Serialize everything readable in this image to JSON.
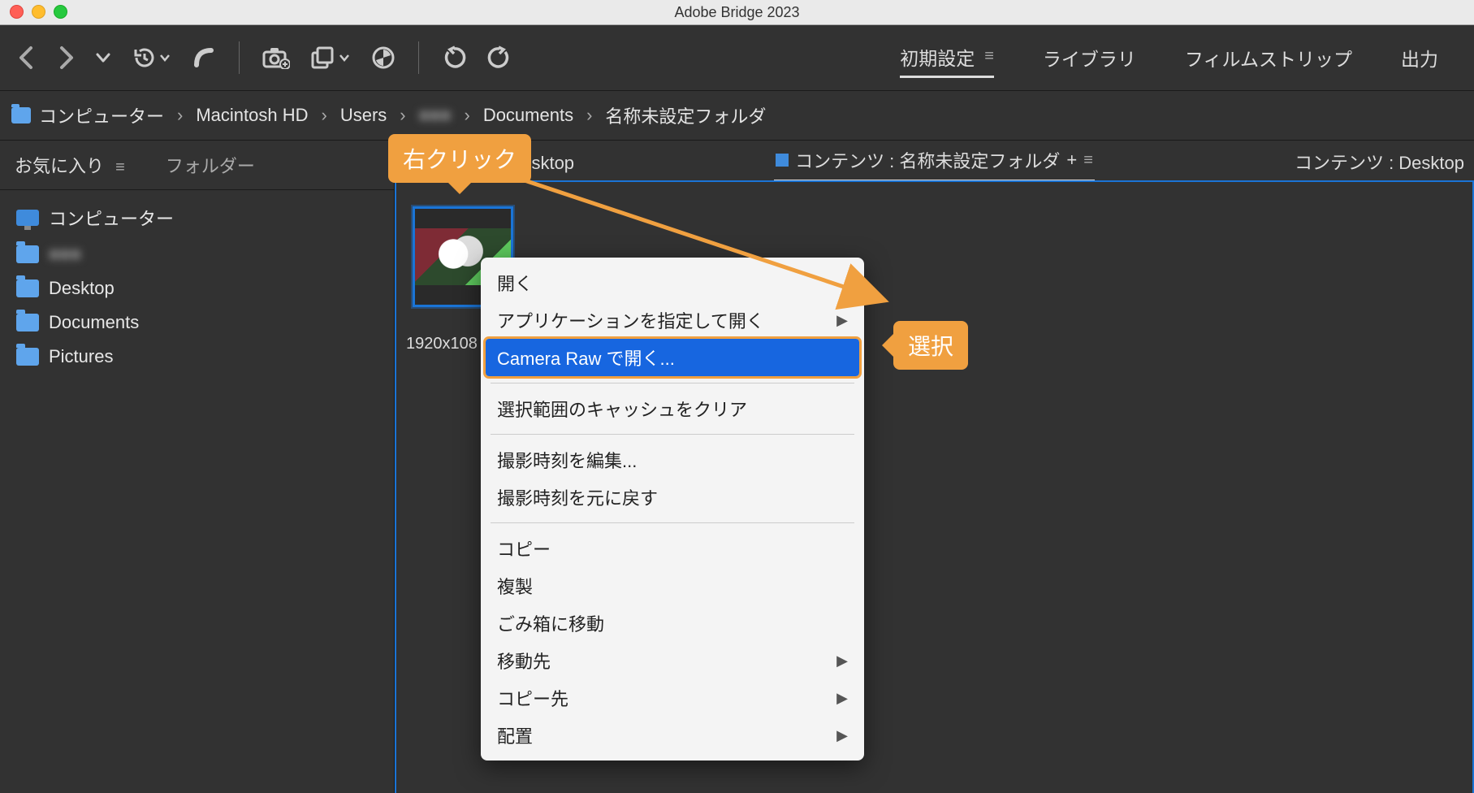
{
  "window": {
    "title": "Adobe Bridge 2023"
  },
  "workspaces": {
    "items": [
      {
        "label": "初期設定",
        "active": true
      },
      {
        "label": "ライブラリ"
      },
      {
        "label": "フィルムストリップ"
      },
      {
        "label": "出力"
      }
    ]
  },
  "breadcrumbs": {
    "root": "コンピューター",
    "items": [
      "Macintosh HD",
      "Users",
      "■■■",
      "Documents",
      "名称未設定フォルダ"
    ]
  },
  "sidebar": {
    "tabs": {
      "favorites": "お気に入り",
      "folders": "フォルダー"
    },
    "items": [
      {
        "kind": "computer",
        "label": "コンピューター"
      },
      {
        "kind": "folder",
        "label": "■■■",
        "blurred": true
      },
      {
        "kind": "folder",
        "label": "Desktop"
      },
      {
        "kind": "folder",
        "label": "Documents"
      },
      {
        "kind": "folder",
        "label": "Pictures"
      }
    ]
  },
  "content_tabs": {
    "left": {
      "label": "コンテンツ : Desktop"
    },
    "center": {
      "label": "コンテンツ : 名称未設定フォルダ",
      "plus": "+"
    },
    "right": {
      "label": "コンテンツ : Desktop"
    }
  },
  "thumbnail": {
    "label": "1920x108"
  },
  "context_menu": {
    "items": [
      {
        "label": "開く"
      },
      {
        "label": "アプリケーションを指定して開く",
        "submenu": true
      },
      {
        "label": "Camera Raw で開く...",
        "highlight": true
      },
      {
        "sep": true
      },
      {
        "label": "選択範囲のキャッシュをクリア"
      },
      {
        "sep": true
      },
      {
        "label": "撮影時刻を編集..."
      },
      {
        "label": "撮影時刻を元に戻す"
      },
      {
        "sep": true
      },
      {
        "label": "コピー"
      },
      {
        "label": "複製"
      },
      {
        "label": "ごみ箱に移動"
      },
      {
        "label": "移動先",
        "submenu": true
      },
      {
        "label": "コピー先",
        "submenu": true
      },
      {
        "label": "配置",
        "submenu": true
      }
    ]
  },
  "annotations": {
    "right_click": "右クリック",
    "select": "選択"
  }
}
